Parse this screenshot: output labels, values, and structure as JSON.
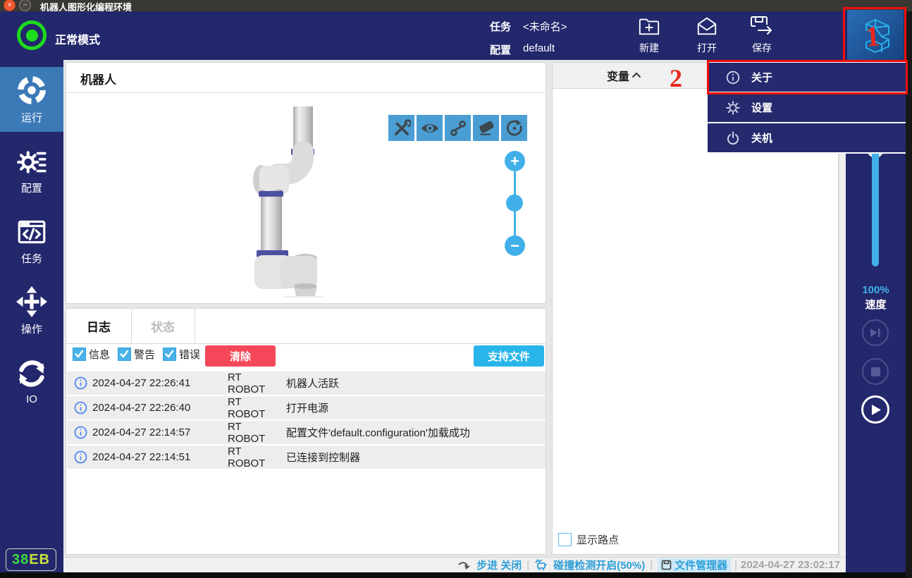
{
  "window": {
    "title": "机器人图形化编程环境"
  },
  "header": {
    "mode": "正常模式",
    "task_label": "任务",
    "task_value": "<未命名>",
    "config_label": "配置",
    "config_value": "default",
    "actions": [
      {
        "label": "新建"
      },
      {
        "label": "打开"
      },
      {
        "label": "保存"
      }
    ]
  },
  "app_menu": {
    "items": [
      {
        "label": "关于"
      },
      {
        "label": "设置"
      },
      {
        "label": "关机"
      }
    ]
  },
  "annotations": {
    "step1": "1",
    "step2": "2"
  },
  "sidebar": {
    "items": [
      {
        "label": "运行"
      },
      {
        "label": "配置"
      },
      {
        "label": "任务"
      },
      {
        "label": "操作"
      },
      {
        "label": "IO"
      }
    ],
    "badge_part1": "38",
    "badge_part2": "EB"
  },
  "robot_panel": {
    "title": "机器人"
  },
  "log_panel": {
    "tabs": [
      {
        "label": "日志"
      },
      {
        "label": "状态"
      }
    ],
    "filters": [
      {
        "label": "信息"
      },
      {
        "label": "警告"
      },
      {
        "label": "错误"
      }
    ],
    "clear_label": "清除",
    "support_label": "支持文件",
    "entries": [
      {
        "time": "2024-04-27 22:26:41",
        "source": "RT ROBOT",
        "message": "机器人活跃"
      },
      {
        "time": "2024-04-27 22:26:40",
        "source": "RT ROBOT",
        "message": "打开电源"
      },
      {
        "time": "2024-04-27 22:14:57",
        "source": "RT ROBOT",
        "message": "配置文件'default.configuration'加载成功"
      },
      {
        "time": "2024-04-27 22:14:51",
        "source": "RT ROBOT",
        "message": "已连接到控制器"
      }
    ]
  },
  "variables_panel": {
    "title": "变量",
    "show_waypoints_label": "显示路点"
  },
  "speed_control": {
    "value": "100%",
    "label": "速度"
  },
  "status_bar": {
    "step_label": "步进 关闭",
    "collision_label": "碰撞检测开启(50%)",
    "file_manager_label": "文件管理器",
    "timestamp": "2024-04-27 23:02:17"
  },
  "colors": {
    "header_navy": "#23276c",
    "active_item_blue": "#3b79b7",
    "accent_blue": "#41b0e8",
    "toolbar_blue": "#4a9ed3",
    "clear_red": "#f4485a",
    "support_cyan": "#29b5e9",
    "status_blue": "#2d9fd8",
    "indicator_green": "#1ddb1d",
    "annotation_red": "#ee1c12",
    "logo_cyan": "#27b1e6"
  }
}
